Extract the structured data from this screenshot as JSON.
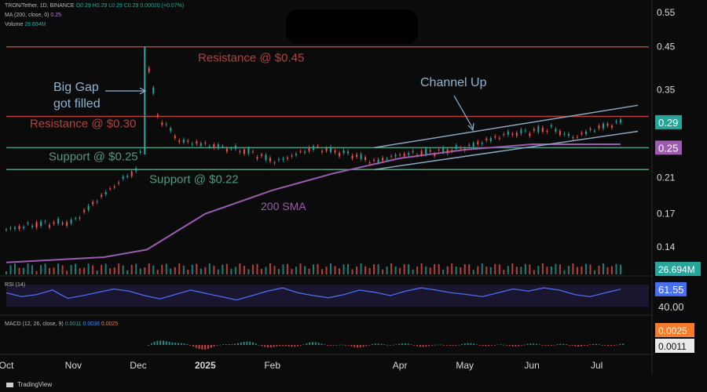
{
  "header": {
    "symbol_line": "TRON/Tether, 1D, BINANCE",
    "ohlc": "O0.29 H0.29 L0.29 C0.29 0.00020 (+0.07%)",
    "ma_line_label": "MA (200, close, 0)",
    "ma_line_value": "0.25",
    "volume_label": "Volume",
    "volume_value": "26.694M",
    "rsi_label": "RSI (14)",
    "macd_label": "MACD (12, 26, close, 9)",
    "macd_values": [
      "0.0011",
      "0.0036",
      "0.0025"
    ]
  },
  "footer": {
    "brand": "TradingView"
  },
  "colors": {
    "background": "#0b0b0b",
    "up": "#26a69a",
    "down": "#ef5350",
    "resistance": "#b8403c",
    "support": "#4f9a80",
    "sma": "#9c5bb0",
    "channel": "#8aa6c0",
    "rsi": "#4a6ef0",
    "annotation_blue": "#8fb4d0",
    "label_green": "#26a69a",
    "macd_orange": "#f57c2a"
  },
  "chart_data": {
    "type": "line",
    "title": "",
    "xlabel": "",
    "ylabel": "",
    "x_ticks": [
      "Oct",
      "Nov",
      "Dec",
      "2025",
      "Feb",
      "Apr",
      "May",
      "Jun",
      "Jul"
    ],
    "x_tick_dates": [
      "2024-10-01",
      "2024-11-01",
      "2024-12-01",
      "2025-01-01",
      "2025-02-01",
      "2025-04-01",
      "2025-05-01",
      "2025-06-01",
      "2025-07-01"
    ],
    "y_ticks": [
      "0.55",
      "0.45",
      "0.35",
      "0.29",
      "0.25",
      "0.21",
      "0.17",
      "0.14"
    ],
    "y_scale": "log",
    "ylim": [
      0.125,
      0.57
    ],
    "xlim": [
      "2024-10-01",
      "2025-07-20"
    ],
    "grid": false,
    "price_series": {
      "name": "",
      "dates": [
        "2024-10-01",
        "2024-10-15",
        "2024-11-01",
        "2024-11-10",
        "2024-11-20",
        "2024-11-25",
        "2024-11-30",
        "2024-12-03",
        "2024-12-04",
        "2024-12-10",
        "2024-12-20",
        "2024-12-31",
        "2025-01-20",
        "2025-02-03",
        "2025-02-20",
        "2025-03-10",
        "2025-03-20",
        "2025-04-01",
        "2025-04-20",
        "2025-05-01",
        "2025-05-20",
        "2025-06-01",
        "2025-06-10",
        "2025-06-20",
        "2025-07-01",
        "2025-07-12"
      ],
      "values": [
        0.155,
        0.16,
        0.162,
        0.18,
        0.2,
        0.21,
        0.22,
        0.25,
        0.44,
        0.3,
        0.26,
        0.255,
        0.245,
        0.23,
        0.25,
        0.24,
        0.23,
        0.24,
        0.245,
        0.25,
        0.27,
        0.275,
        0.28,
        0.265,
        0.28,
        0.29
      ]
    },
    "sma_series": {
      "name": "200 SMA",
      "dates": [
        "2024-10-01",
        "2024-11-15",
        "2024-12-05",
        "2025-01-01",
        "2025-02-01",
        "2025-03-01",
        "2025-04-01",
        "2025-05-01",
        "2025-06-01",
        "2025-07-12"
      ],
      "values": [
        0.128,
        0.132,
        0.138,
        0.17,
        0.195,
        0.215,
        0.235,
        0.247,
        0.255,
        0.255
      ]
    },
    "levels": [
      {
        "label": "Resistance @ $0.45",
        "value": 0.45,
        "kind": "resistance"
      },
      {
        "label": "Resistance @ $0.30",
        "value": 0.3,
        "kind": "resistance"
      },
      {
        "label": "Support @ $0.25",
        "value": 0.25,
        "kind": "support"
      },
      {
        "label": "Support @ $0.22",
        "value": 0.22,
        "kind": "support"
      }
    ],
    "channel": {
      "label": "Channel Up",
      "upper": {
        "start": [
          "2025-03-20",
          0.25
        ],
        "end": [
          "2025-07-20",
          0.32
        ]
      },
      "lower": {
        "start": [
          "2025-03-20",
          0.22
        ],
        "end": [
          "2025-07-20",
          0.275
        ]
      }
    },
    "annotations": {
      "gap_line1": "Big Gap",
      "gap_line2": "got filled",
      "sma_label": "200 SMA",
      "channel_label": "Channel Up"
    },
    "price_labels": {
      "last": "0.29",
      "ma": "0.25"
    },
    "volume": {
      "label": "26.694M",
      "last": 26.694,
      "unit": "M"
    },
    "rsi": {
      "label": "RSI (14)",
      "value": 61.55,
      "value_label": "61.55",
      "level": "40.00",
      "ylim": [
        20,
        80
      ],
      "values": [
        55,
        48,
        52,
        60,
        45,
        50,
        56,
        62,
        58,
        50,
        44,
        52,
        60,
        54,
        48,
        42,
        50,
        58,
        64,
        55,
        50,
        46,
        52,
        60,
        56,
        50,
        58,
        64,
        60,
        55,
        52,
        48,
        55,
        62,
        58,
        64,
        60,
        52,
        48,
        55,
        61.55
      ]
    },
    "macd": {
      "label": "MACD (12, 26, close, 9)",
      "macd": 0.0011,
      "signal": 0.0025,
      "hist": 0.0036,
      "signal_label": "0.0025",
      "macd_label": "0.0011"
    }
  }
}
